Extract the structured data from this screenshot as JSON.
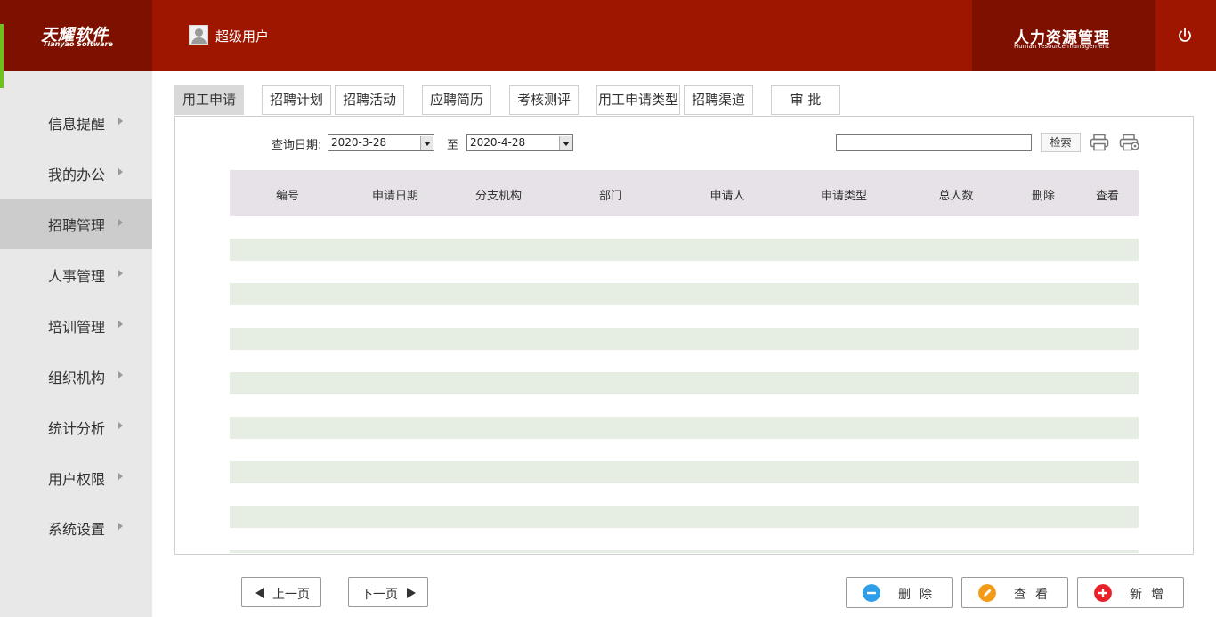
{
  "brand": {
    "logo_cn": "天耀软件",
    "logo_en": "Tianyao Software",
    "system_cn": "人力资源管理",
    "system_en": "Human resource management"
  },
  "user": {
    "name": "超级用户"
  },
  "colors": {
    "header": "#9e1600",
    "header_dark": "#7e1000",
    "sidebar": "#e8e8e8",
    "sidebar_active": "#cccccc",
    "accent_green": "#6cc11f",
    "row_stripe": "#e6ede3",
    "table_header": "#e7e2e7"
  },
  "sidebar": {
    "items": [
      {
        "label": "信息提醒"
      },
      {
        "label": "我的办公"
      },
      {
        "label": "招聘管理",
        "active": true
      },
      {
        "label": "人事管理"
      },
      {
        "label": "培训管理"
      },
      {
        "label": "组织机构"
      },
      {
        "label": "统计分析"
      },
      {
        "label": "用户权限"
      },
      {
        "label": "系统设置"
      }
    ]
  },
  "tabs": [
    {
      "label": "用工申请",
      "active": true
    },
    {
      "label": "招聘计划"
    },
    {
      "label": "招聘活动"
    },
    {
      "label": "应聘简历"
    },
    {
      "label": "考核测评"
    },
    {
      "label": "用工申请类型"
    },
    {
      "label": "招聘渠道"
    },
    {
      "label": "审 批"
    }
  ],
  "filter": {
    "query_label": "查询日期:",
    "date_from": "2020-3-28",
    "to_label": "至",
    "date_to": "2020-4-28",
    "search_value": "",
    "search_button": "检索"
  },
  "table": {
    "columns": [
      "编号",
      "申请日期",
      "分支机构",
      "部门",
      "申请人",
      "申请类型",
      "总人数",
      "删除",
      "查看"
    ],
    "rows": []
  },
  "pager": {
    "prev": "上一页",
    "next": "下一页"
  },
  "actions": {
    "delete": "删除",
    "view": "查看",
    "add": "新增"
  }
}
